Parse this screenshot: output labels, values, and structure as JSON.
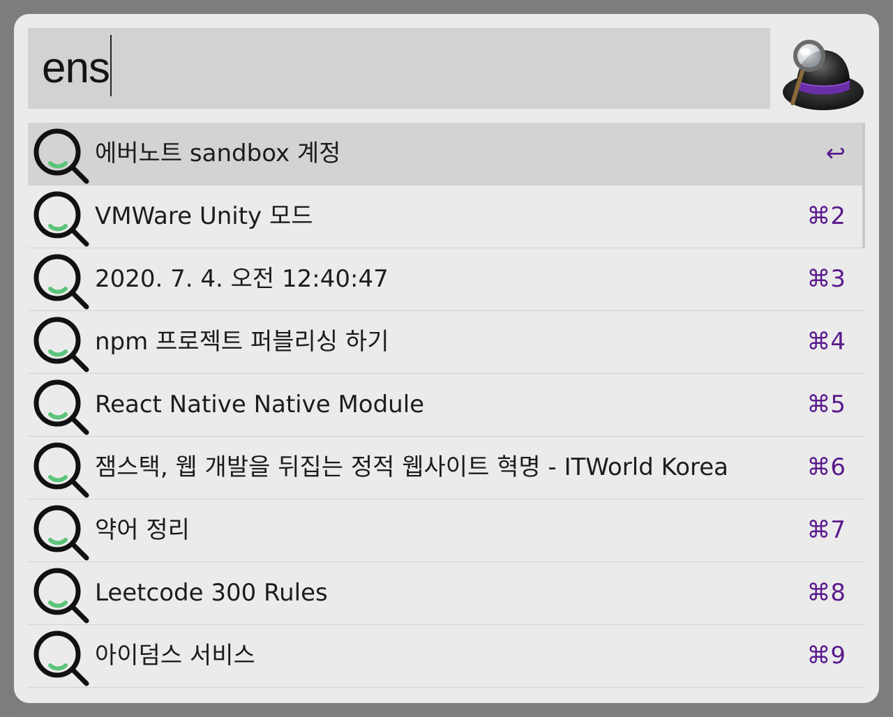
{
  "search": {
    "query": "ens"
  },
  "results": [
    {
      "title": "에버노트 sandbox 계정",
      "shortcut": "↩"
    },
    {
      "title": "VMWare Unity 모드",
      "shortcut": "⌘2"
    },
    {
      "title": "2020. 7. 4. 오전 12:40:47",
      "shortcut": "⌘3"
    },
    {
      "title": "npm 프로젝트 퍼블리싱 하기",
      "shortcut": "⌘4"
    },
    {
      "title": "React Native Native Module",
      "shortcut": "⌘5"
    },
    {
      "title": "잼스택, 웹 개발을 뒤집는 정적 웹사이트 혁명 - ITWorld Korea",
      "shortcut": "⌘6"
    },
    {
      "title": "약어 정리",
      "shortcut": "⌘7"
    },
    {
      "title": "Leetcode 300 Rules",
      "shortcut": "⌘8"
    },
    {
      "title": "아이덤스 서비스",
      "shortcut": "⌘9"
    }
  ],
  "icons": {
    "result_icon": "magnifier-icon",
    "logo": "alfred-hat-logo-icon"
  },
  "colors": {
    "shortcut": "#5a1a8c",
    "selected_row": "#d3d3d3",
    "window": "#ebebeb",
    "search_box": "#d2d2d2",
    "icon_accent": "#5cc47a"
  }
}
